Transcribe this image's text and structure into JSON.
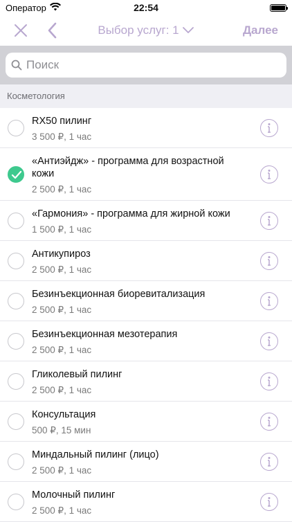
{
  "status": {
    "carrier": "Оператор",
    "time": "22:54"
  },
  "nav": {
    "title": "Выбор услуг: 1",
    "next_label": "Далее"
  },
  "search": {
    "placeholder": "Поиск"
  },
  "section": {
    "title": "Косметология"
  },
  "services": [
    {
      "name": "RX50 пилинг",
      "meta": "3 500 ₽, 1 час",
      "selected": false
    },
    {
      "name": "«Антиэйдж» - программа для возрастной кожи",
      "meta": "2 500 ₽, 1 час",
      "selected": true
    },
    {
      "name": "«Гармония» - программа для жирной кожи",
      "meta": "1 500 ₽, 1 час",
      "selected": false
    },
    {
      "name": "Антикупироз",
      "meta": "2 500 ₽, 1 час",
      "selected": false
    },
    {
      "name": "Безинъекционная биоревитализация",
      "meta": "2 500 ₽, 1 час",
      "selected": false
    },
    {
      "name": "Безинъекционная мезотерапия",
      "meta": "2 500 ₽, 1 час",
      "selected": false
    },
    {
      "name": "Гликолевый пилинг",
      "meta": "2 500 ₽, 1 час",
      "selected": false
    },
    {
      "name": "Консультация",
      "meta": "500 ₽,  15 мин",
      "selected": false
    },
    {
      "name": "Миндальный пилинг (лицо)",
      "meta": "2 500 ₽, 1 час",
      "selected": false
    },
    {
      "name": "Молочный пилинг",
      "meta": "2 500 ₽, 1 час",
      "selected": false
    }
  ],
  "colors": {
    "accent": "#b8a7cf",
    "check": "#3ec98e"
  }
}
